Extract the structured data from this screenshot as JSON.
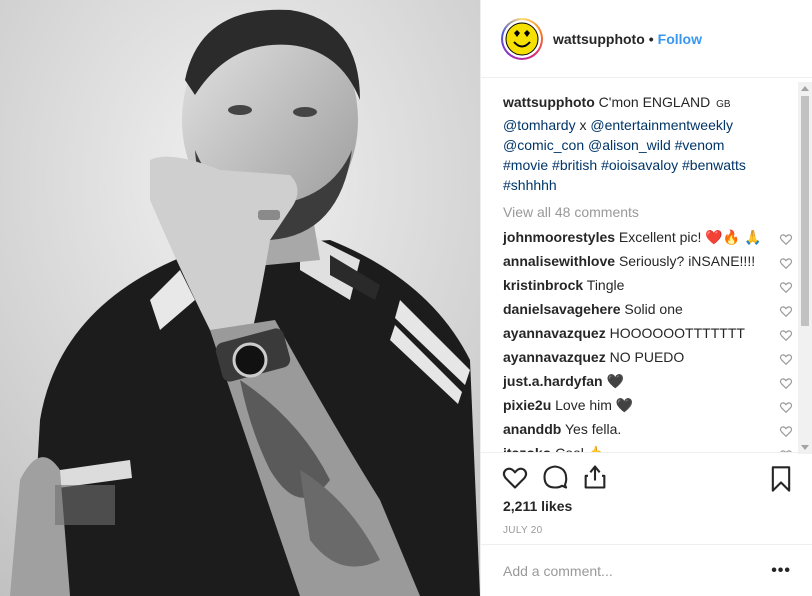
{
  "post": {
    "username": "wattsupphoto",
    "separator": "•",
    "follow_label": "Follow",
    "image_alt": "black and white portrait photo"
  },
  "caption": {
    "username": "wattsupphoto",
    "text_start": "C'mon ENGLAND",
    "flag_text": "GB",
    "segments": [
      {
        "text": "@tomhardy",
        "link": true
      },
      {
        "text": " x ",
        "link": false
      },
      {
        "text": "@entertainmentweekly",
        "link": true
      },
      {
        "text": " ",
        "link": false
      },
      {
        "text": "@comic_con",
        "link": true
      },
      {
        "text": " ",
        "link": false
      },
      {
        "text": "@alison_wild",
        "link": true
      },
      {
        "text": " ",
        "link": false
      },
      {
        "text": "#venom",
        "link": true
      },
      {
        "text": " ",
        "link": false
      },
      {
        "text": "#movie",
        "link": true
      },
      {
        "text": " ",
        "link": false
      },
      {
        "text": "#british",
        "link": true
      },
      {
        "text": " ",
        "link": false
      },
      {
        "text": "#oioisavaloy",
        "link": true
      },
      {
        "text": " ",
        "link": false
      },
      {
        "text": "#benwatts",
        "link": true
      },
      {
        "text": " ",
        "link": false
      },
      {
        "text": "#shhhhh",
        "link": true
      }
    ]
  },
  "view_all_comments": "View all 48 comments",
  "comments": [
    {
      "user": "johnmoorestyles",
      "text": "Excellent pic! ❤️🔥 🙏"
    },
    {
      "user": "annalisewithlove",
      "text": "Seriously? iNSANE!!!!"
    },
    {
      "user": "kristinbrock",
      "text": "Tingle"
    },
    {
      "user": "danielsavagehere",
      "text": "Solid one"
    },
    {
      "user": "ayannavazquez",
      "text": "HOOOOOOTTTTTTT"
    },
    {
      "user": "ayannavazquez",
      "text": "NO PUEDO"
    },
    {
      "user": "just.a.hardyfan",
      "text": "🖤"
    },
    {
      "user": "pixie2u",
      "text": "Love him 🖤"
    },
    {
      "user": "ananddb",
      "text": "Yes fella."
    },
    {
      "user": "itszoko",
      "text": "Cool 🤙"
    }
  ],
  "likes": "2,211 likes",
  "date": "JULY 20",
  "add_comment_placeholder": "Add a comment...",
  "more_label": "•••",
  "colors": {
    "link": "#003569",
    "follow": "#3897f0",
    "muted": "#999999",
    "avatar_yellow": "#f5e000"
  },
  "icons": {
    "like": "heart-icon",
    "comment": "comment-bubble-icon",
    "share": "share-icon",
    "save": "bookmark-icon",
    "comment_like": "small-heart-icon",
    "avatar": "smiley-face-icon"
  }
}
